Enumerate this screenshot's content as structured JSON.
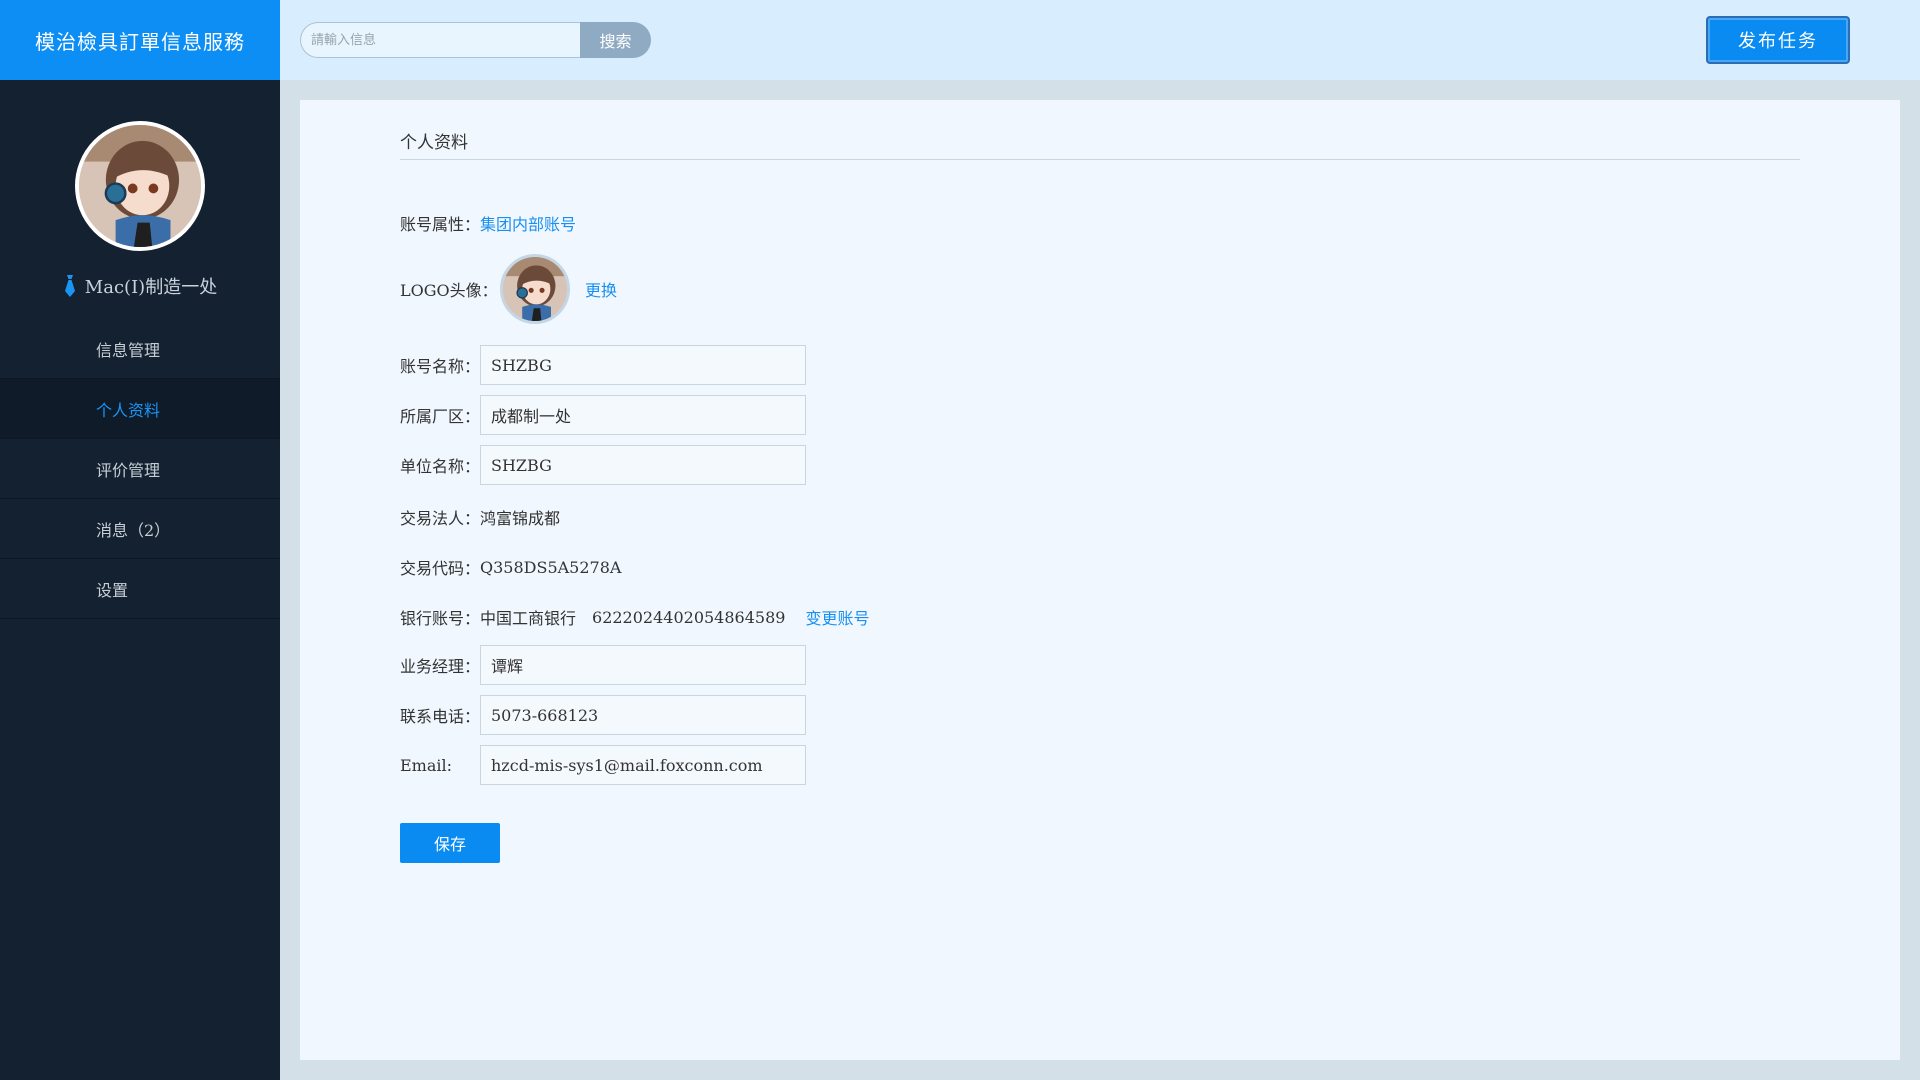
{
  "app": {
    "title": "模治檢具訂單信息服務"
  },
  "search": {
    "placeholder": "請輸入信息",
    "button_label": "搜索"
  },
  "header": {
    "publish_label": "发布任务"
  },
  "user": {
    "name": "Mac(I)制造一处"
  },
  "sidebar": {
    "items": [
      {
        "label": "信息管理"
      },
      {
        "label": "个人资料"
      },
      {
        "label": "评价管理"
      },
      {
        "label": "消息（2）"
      },
      {
        "label": "设置"
      }
    ]
  },
  "profile": {
    "section_title": "个人资料",
    "account_type_label": "账号属性：",
    "account_type_value": "集团内部账号",
    "logo_label": "LOGO头像：",
    "logo_change": "更换",
    "account_name_label": "账号名称：",
    "account_name_value": "SHZBG",
    "plant_label": "所属厂区：",
    "plant_value": "成都制一处",
    "unit_label": "单位名称：",
    "unit_value": "SHZBG",
    "legal_person_label": "交易法人：",
    "legal_person_value": "鸿富锦成都",
    "trade_code_label": "交易代码：",
    "trade_code_value": "Q358DS5A5278A",
    "bank_label": "银行账号：",
    "bank_name": "中国工商银行",
    "bank_number": "6222024402054864589",
    "bank_change": "变更账号",
    "manager_label": "业务经理：",
    "manager_value": "谭辉",
    "phone_label": "联系电话：",
    "phone_value": "5073-668123",
    "email_label": "Email:",
    "email_value": "hzcd-mis-sys1@mail.foxconn.com",
    "save_label": "保存"
  },
  "colors": {
    "accent": "#0a8bf2",
    "sidebar_bg": "#142130",
    "topbar_bg": "#d8edfd",
    "panel_bg": "#f0f7fe",
    "link": "#1b8ff0"
  },
  "icons": {
    "user_badge": "tie-icon"
  }
}
